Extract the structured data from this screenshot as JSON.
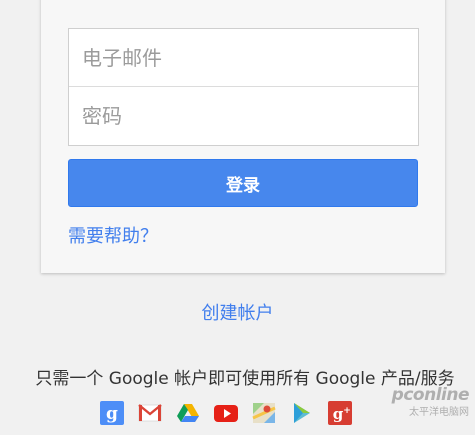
{
  "login": {
    "email_placeholder": "电子邮件",
    "password_placeholder": "密码",
    "signin_label": "登录",
    "help_link": "需要帮助？"
  },
  "create_account_link": "创建帐户",
  "tagline": "只需一个 Google 帐户即可使用所有 Google 产品/服务",
  "products": [
    {
      "name": "Google+",
      "icon": "google-plus-icon"
    },
    {
      "name": "Gmail",
      "icon": "gmail-icon"
    },
    {
      "name": "Drive",
      "icon": "drive-icon"
    },
    {
      "name": "YouTube",
      "icon": "youtube-icon"
    },
    {
      "name": "Maps",
      "icon": "maps-icon"
    },
    {
      "name": "Play",
      "icon": "play-icon"
    },
    {
      "name": "Google+",
      "icon": "google-plus-red-icon"
    }
  ],
  "watermark": {
    "brand": "pconline",
    "subtitle": "太平洋电脑网"
  },
  "colors": {
    "accent": "#4787ed",
    "link": "#427fed",
    "background": "#f1f1f1"
  }
}
